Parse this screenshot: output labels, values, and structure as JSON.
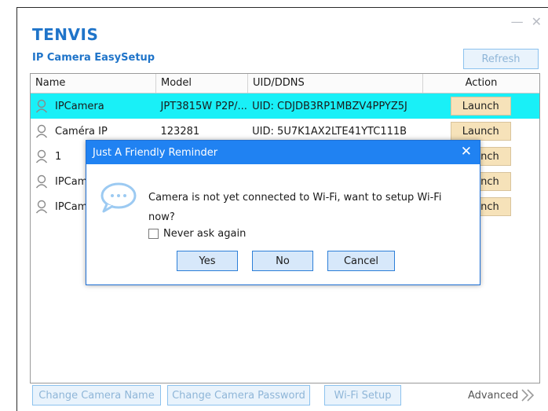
{
  "app": {
    "logo": "TENVIS",
    "title": "IP Camera EasySetup",
    "refresh_label": "Refresh",
    "minimize_icon": "minimize-icon",
    "close_icon": "close-icon"
  },
  "table": {
    "headers": {
      "name": "Name",
      "model": "Model",
      "uid": "UID/DDNS",
      "action": "Action"
    },
    "rows": [
      {
        "name": "IPCamera",
        "model": "JPT3815W P2P/...",
        "uid": "UID: CDJDB3RP1MBZV4PPYZ5J",
        "action": "Launch"
      },
      {
        "name": "Caméra IP",
        "model": "123281",
        "uid": "UID: 5U7K1AX2LTE41YTC111B",
        "action": "Launch"
      },
      {
        "name": "1",
        "model": "",
        "uid": "",
        "action": "Launch"
      },
      {
        "name": "IPCam",
        "model": "",
        "uid": "",
        "action": "Launch"
      },
      {
        "name": "IPCam",
        "model": "",
        "uid": "",
        "action": "Launch"
      }
    ]
  },
  "bottom": {
    "change_name": "Change Camera Name",
    "change_password": "Change Camera Password",
    "wifi_setup": "Wi-Fi Setup",
    "advanced": "Advanced"
  },
  "dialog": {
    "title": "Just A Friendly Reminder",
    "message": "Camera is not yet connected to Wi-Fi, want to setup Wi-Fi now?",
    "checkbox_label": "Never ask again",
    "yes": "Yes",
    "no": "No",
    "cancel": "Cancel"
  },
  "colors": {
    "brand": "#1f74c9",
    "selected_row": "#19f0f7",
    "dialog_title": "#2082f2",
    "launch_bg": "#f6e2b9"
  }
}
